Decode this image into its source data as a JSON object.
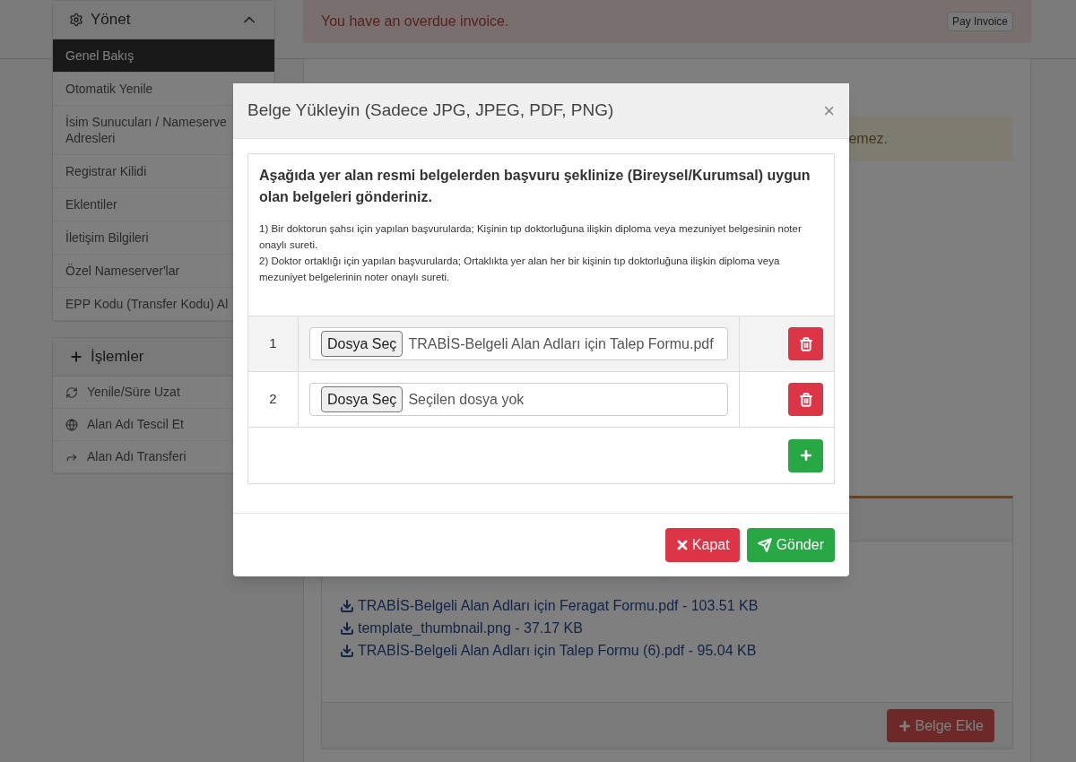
{
  "sidebar": {
    "manage": {
      "title": "Yönet",
      "expanded": true,
      "items": [
        {
          "label": "Genel Bakış",
          "selected": true
        },
        {
          "label": "Otomatik Yenile",
          "selected": false
        },
        {
          "label": "İsim Sunucuları / Nameserve",
          "label_2": "Adresleri",
          "selected": false
        },
        {
          "label": "Registrar Kilidi",
          "selected": false
        },
        {
          "label": "Eklentiler",
          "selected": false
        },
        {
          "label": "İletişim Bilgileri",
          "selected": false
        },
        {
          "label": "Özel Nameserver'lar",
          "selected": false
        },
        {
          "label": "EPP Kodu (Transfer Kodu) Al",
          "selected": false
        }
      ]
    },
    "actions": {
      "title": "İşlemler",
      "items": [
        {
          "label": "Yenile/Süre Uzat"
        },
        {
          "label": "Alan Adı Tescil Et"
        },
        {
          "label": "Alan Adı Transferi"
        }
      ]
    }
  },
  "alert": {
    "text": "You have an overdue invoice.",
    "button": "Pay Invoice"
  },
  "warning_alert": {
    "text": "emez."
  },
  "documents": {
    "files": [
      {
        "name": "TRABİS-Belgeli Alan Adları için Feragat Formu.pdf - 103.51 KB"
      },
      {
        "name": "template_thumbnail.png - 37.17 KB"
      },
      {
        "name": "TRABİS-Belgeli Alan Adları için Talep Formu (6).pdf - 95.04 KB"
      }
    ],
    "add_button": "Belge Ekle"
  },
  "modal": {
    "title": "Belge Yükleyin (Sadece JPG, JPEG, PDF, PNG)",
    "close": "×",
    "heading": "Aşağıda yer alan resmi belgelerden başvuru şeklinize (Bireysel/Kurumsal) uygun olan belgeleri gönderiniz.",
    "notes": [
      "1) Bir doktorun şahsı için yapılan başvurularda; Kişinin tıp doktorluğuna ilişkin diploma veya mezuniyet belgesinin noter onaylı sureti.",
      "2) Doktor ortaklığı için yapılan başvurularda; Ortaklıkta yer alan her bir kişinin tıp doktorluğuna ilişkin diploma veya mezuniyet belgelerinin noter onaylı sureti."
    ],
    "rows": [
      {
        "number": "1",
        "button": "Dosya Seç",
        "file_name": "TRABİS-Belgeli Alan Adları için Talep Formu.pdf"
      },
      {
        "number": "2",
        "button": "Dosya Seç",
        "file_name": "Seçilen dosya yok"
      }
    ],
    "close_button": "Kapat",
    "submit_button": "Gönder"
  }
}
